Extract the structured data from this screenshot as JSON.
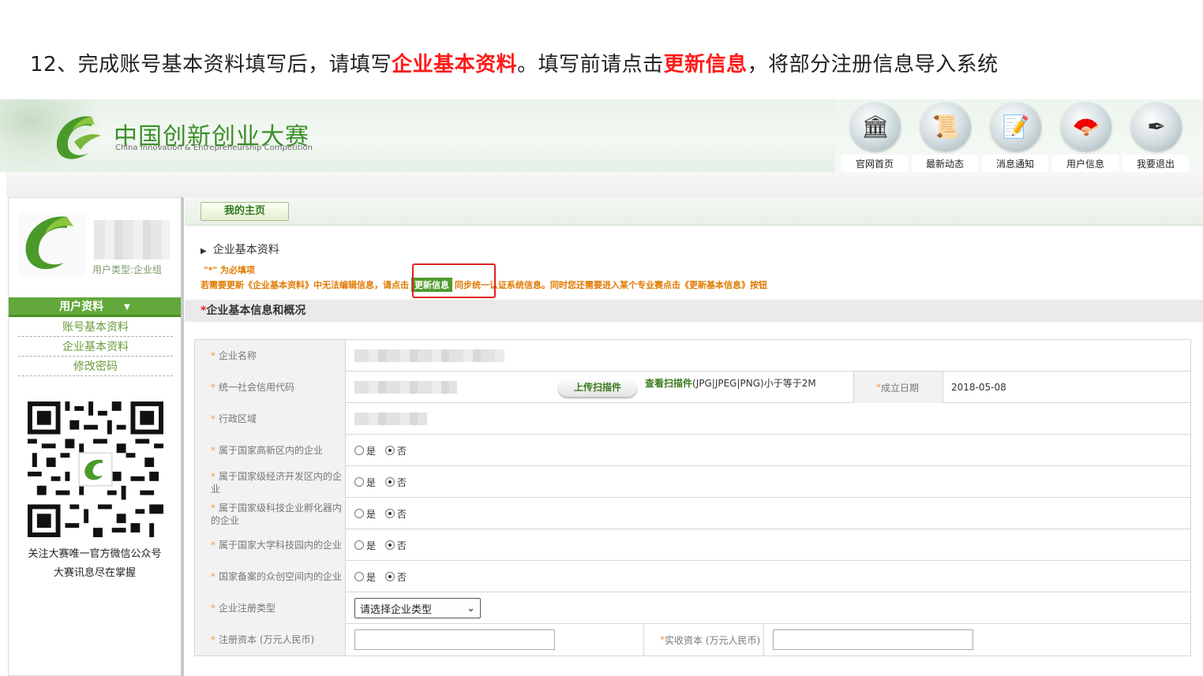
{
  "instruction": {
    "part1": "12、完成账号基本资料填写后，请填写",
    "highlight1": "企业基本资料",
    "part2": "。填写前请点击",
    "highlight2": "更新信息",
    "part3": "，将部分注册信息导入系统"
  },
  "header": {
    "logo_cn": "中国创新创业大赛",
    "logo_en": "China Innovation & Entrepreneurship Competition",
    "nav": [
      {
        "label": "官网首页",
        "icon": "building-icon"
      },
      {
        "label": "最新动态",
        "icon": "scroll-icon"
      },
      {
        "label": "消息通知",
        "icon": "notepad-icon"
      },
      {
        "label": "用户信息",
        "icon": "fan-icon"
      },
      {
        "label": "我要退出",
        "icon": "exit-icon"
      }
    ]
  },
  "sidebar": {
    "user_type": "用户类型:企业组",
    "menu_title": "用户资料",
    "items": [
      "账号基本资料",
      "企业基本资料",
      "修改密码"
    ],
    "qr_caption1": "关注大赛唯一官方微信公众号",
    "qr_caption2": "大赛讯息尽在掌握"
  },
  "main": {
    "home_button": "我的主页",
    "section_title": "企业基本资料",
    "required_note": "\"*\"  为必填项",
    "update_note_pre": "若需要更新《企业基本资料》中无法编辑信息，请点击",
    "update_button": "更新信息",
    "update_note_post": "同步统一认证系统信息。同时您还需要进入某个专业赛点击《更新基本信息》按钮",
    "subheading": "企业基本信息和概况",
    "form": {
      "company_name_label": "企业名称",
      "credit_code_label": "统一社会信用代码",
      "upload_button": "上传扫描件",
      "view_scan_link": "查看扫描件",
      "view_scan_hint": "(JPG|JPEG|PNG)小于等于2M",
      "found_date_label": "成立日期",
      "found_date_value": "2018-05-08",
      "region_label": "行政区域",
      "hightech_label": "属于国家高新区内的企业",
      "econ_zone_label": "属于国家级经济开发区内的企业",
      "incubator_label": "属于国家级科技企业孵化器内的企业",
      "univ_park_label": "属于国家大学科技园内的企业",
      "makerspace_label": "国家备案的众创空间内的企业",
      "yes_label": "是",
      "no_label": "否",
      "reg_type_label": "企业注册类型",
      "reg_type_value": "请选择企业类型",
      "reg_capital_label": "注册资本 (万元人民币)",
      "paid_capital_label": "实收资本 (万元人民币)"
    }
  },
  "colors": {
    "accent_green": "#63a83b",
    "highlight_red": "#ff1a1a",
    "note_orange": "#e07a00"
  }
}
